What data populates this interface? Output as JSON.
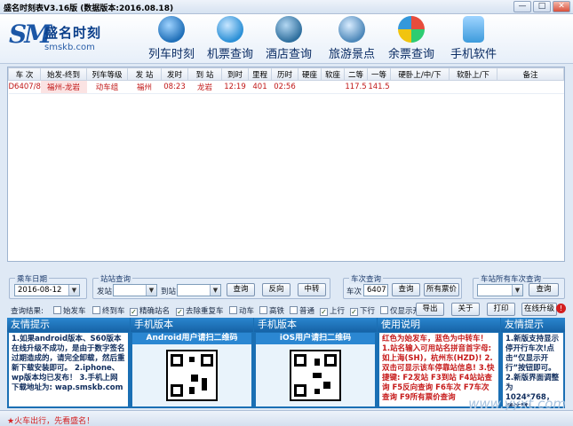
{
  "window": {
    "title": "盛名时刻表V3.16版 (数据版本:2016.08.18)",
    "min": "—",
    "max": "□",
    "close": "✕"
  },
  "logo": {
    "mark": "SM",
    "name": "盛名时刻",
    "url": "smskb.com"
  },
  "nav": [
    {
      "label": "列车时刻",
      "icon": "train-icon",
      "color": "#1f6fb8"
    },
    {
      "label": "机票查询",
      "icon": "airplane-icon",
      "color": "#2a8fd6"
    },
    {
      "label": "酒店查询",
      "icon": "hotel-icon",
      "color": "#2f6f9e"
    },
    {
      "label": "旅游景点",
      "icon": "landmark-icon",
      "color": "#4c87b9"
    },
    {
      "label": "余票查询",
      "icon": "windows-icon",
      "color": "#3a8bd2"
    },
    {
      "label": "手机软件",
      "icon": "mobile-icon",
      "color": "#3d9bdc"
    }
  ],
  "table": {
    "columns": [
      "车 次",
      "始发-终到",
      "列车等级",
      "发 站",
      "发时",
      "到 站",
      "到时",
      "里程",
      "历时",
      "硬座",
      "软座",
      "二等",
      "一等",
      "硬卧上/中/下",
      "软卧上/下",
      "备注"
    ],
    "rows": [
      [
        "D6407/8",
        "福州-龙岩",
        "动车组",
        "福州",
        "08:23",
        "龙岩",
        "12:19",
        "401",
        "02:56",
        "",
        "",
        "117.5",
        "141.5",
        "",
        "",
        ""
      ]
    ]
  },
  "controls": {
    "date_group": "乘车日期",
    "date_value": "2016-08-12",
    "station_group": "站站查询",
    "from_label": "发站",
    "to_label": "到站",
    "query": "查询",
    "reverse": "反向",
    "transfer": "中转",
    "train_group": "车次查询",
    "train_label": "车次",
    "train_value": "6407",
    "train_query": "查询",
    "all_fares": "所有票价",
    "station_group2": "车站所有车次查询",
    "station_query": "查询",
    "result_label": "查询结果:",
    "checks": [
      {
        "label": "始发车",
        "checked": false
      },
      {
        "label": "终到车",
        "checked": false
      },
      {
        "label": "精确站名",
        "checked": true
      },
      {
        "label": "去除重复车",
        "checked": true
      },
      {
        "label": "动车",
        "checked": false
      },
      {
        "label": "高铁",
        "checked": false
      },
      {
        "label": "普通",
        "checked": false
      },
      {
        "label": "上行",
        "checked": true
      },
      {
        "label": "下行",
        "checked": true
      },
      {
        "label": "仅显示开行",
        "checked": false
      }
    ],
    "export": "导出",
    "about": "关于",
    "print": "打印",
    "upgrade": "在线升级"
  },
  "panels": {
    "tip1": {
      "title": "友情提示",
      "text": "1.如果android版本、S60版本在线升级不成功，是由于数字签名过期造成的，请完全卸载，然后重新下载安装即可。 2.iphone、wp版本均已发布！ 3.手机上网下载地址为: wap.smskb.com"
    },
    "android": {
      "title": "手机版本",
      "qr": "Android用户请扫二维码"
    },
    "ios": {
      "title": "手机版本",
      "qr": "iOS用户请扫二维码"
    },
    "usage": {
      "title": "使用说明",
      "text": "红色为始发车，蓝色为中转车！ 1.站名输入可用站名拼音首字母:如上海(SH)，杭州东(HZD)! 2.双击可显示该车停靠站信息! 3.快捷键: F2发站 F3到站 F4站站查询 F5反向查询 F6车次 F7车次查询 F9所有票价查询"
    },
    "tip2": {
      "title": "友情提示",
      "text": "1.新版支持显示停开行车次!点击“仅显示开行”按钮即可。 2.新版界面调整为1024*768，请注意!"
    }
  },
  "status": "★火车出行，先看盛名！",
  "watermark": "www.yyxt.com"
}
